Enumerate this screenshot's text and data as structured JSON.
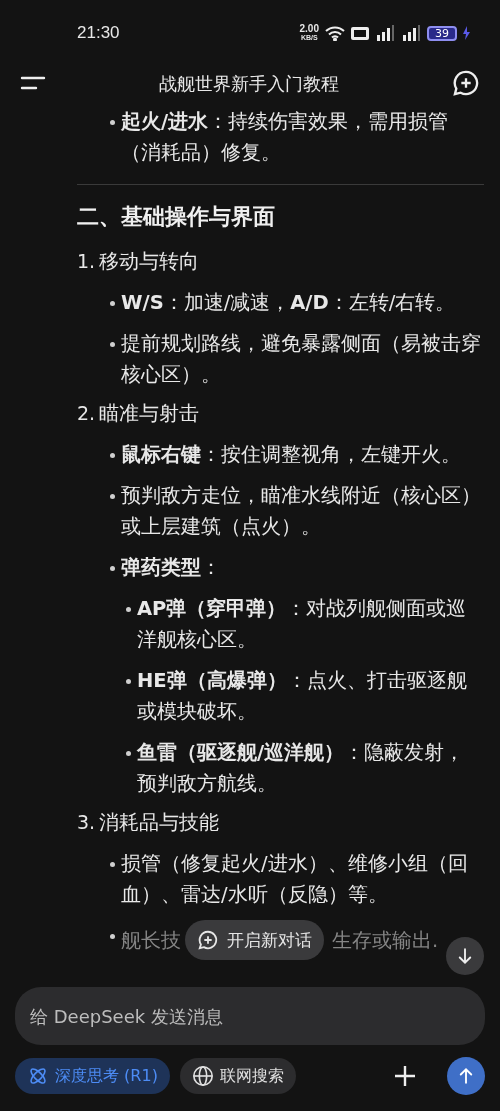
{
  "status_bar": {
    "time": "21:30",
    "net_speed": "2.00",
    "net_unit": "KB/S",
    "battery": "39"
  },
  "header": {
    "title": "战舰世界新手入门教程"
  },
  "content": [
    {
      "kind": "bullet",
      "text": "**起火/进水**：持续伤害效果，需用损管（消耗品）修复。"
    },
    {
      "kind": "divider"
    },
    {
      "kind": "heading",
      "text": "二、基础操作与界面"
    },
    {
      "kind": "numbered",
      "number": "1.",
      "text": "移动与转向",
      "children": [
        {
          "text": "**W/S**：加速/减速，**A/D**：左转/右转。"
        },
        {
          "text": "提前规划路线，避免暴露侧面（易被击穿核心区）。"
        }
      ]
    },
    {
      "kind": "numbered",
      "number": "2.",
      "text": "瞄准与射击",
      "children": [
        {
          "text": "**鼠标右键**：按住调整视角，左键开火。"
        },
        {
          "text": "预判敌方走位，瞄准水线附近（核心区）或上层建筑（点火）。"
        },
        {
          "text": "**弹药类型**：",
          "children": [
            {
              "text": "**AP弹（穿甲弹）**：对战列舰侧面或巡洋舰核心区。"
            },
            {
              "text": "**HE弹（高爆弹）**：点火、打击驱逐舰或模块破坏。"
            },
            {
              "text": "**鱼雷（驱逐舰/巡洋舰）**：隐蔽发射，预判敌方航线。"
            }
          ]
        }
      ]
    },
    {
      "kind": "numbered",
      "number": "3.",
      "text": "消耗品与技能",
      "children": [
        {
          "text": "损管（修复起火/进水）、维修小组（回血）、雷达/水听（反隐）等。"
        },
        {
          "parts": [
            "舰长技",
            "生存或输出."
          ]
        }
      ]
    }
  ],
  "new_chat_button": {
    "label": "开启新对话"
  },
  "input": {
    "placeholder": "给 DeepSeek 发送消息"
  },
  "toggles": [
    {
      "label": "深度思考 (R1)",
      "selected": true
    },
    {
      "label": "联网搜索",
      "selected": false
    }
  ]
}
